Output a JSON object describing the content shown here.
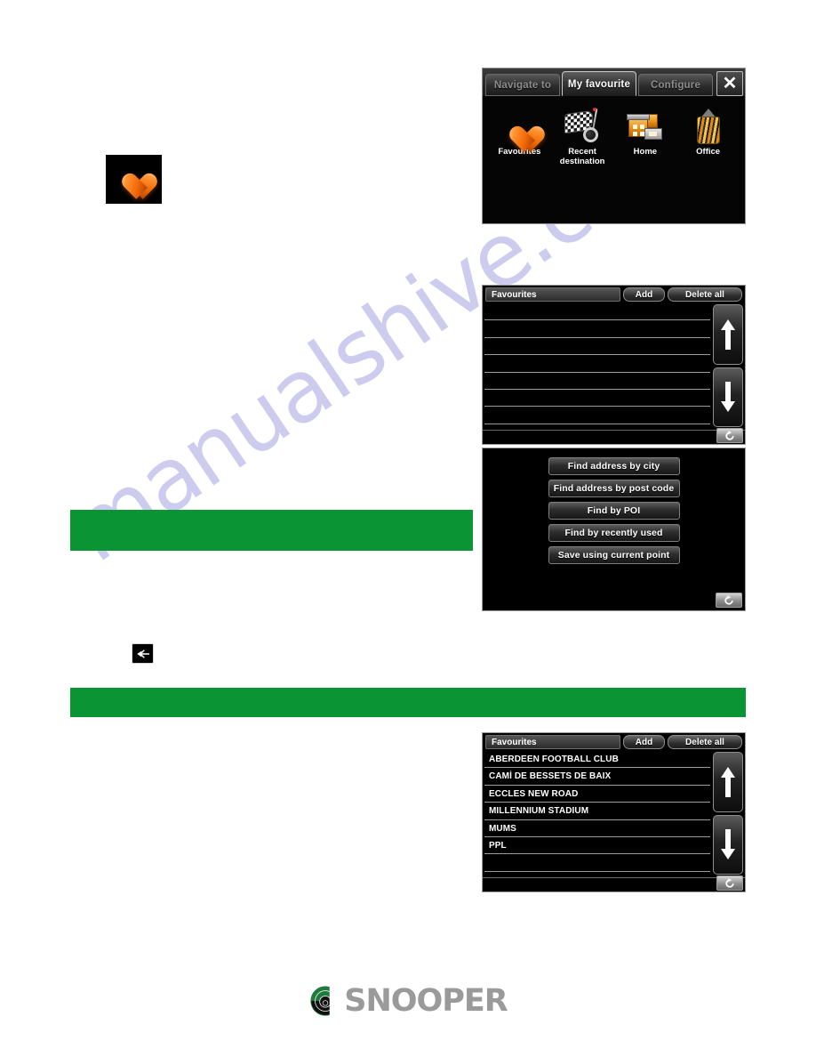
{
  "document": {
    "brand": "SNOOPER",
    "watermark": "manualshive.com"
  },
  "menu_panel": {
    "tabs": [
      {
        "label": "Navigate to",
        "active": false
      },
      {
        "label": "My favourite",
        "active": true
      },
      {
        "label": "Configure",
        "active": false
      }
    ],
    "close_label": "✕",
    "items": [
      {
        "label": "Favourites",
        "icon": "heart-icon"
      },
      {
        "label": "Recent destination",
        "icon": "checkered-flag-icon"
      },
      {
        "label": "Home",
        "icon": "home-icon"
      },
      {
        "label": "Office",
        "icon": "office-building-icon"
      }
    ]
  },
  "favourites_empty": {
    "title": "Favourites",
    "add_label": "Add",
    "delete_all_label": "Delete all",
    "rows": [
      "",
      "",
      "",
      "",
      "",
      "",
      ""
    ],
    "scroll_up_icon": "arrow-up-icon",
    "scroll_down_icon": "arrow-down-icon",
    "back_icon": "refresh-back-icon"
  },
  "find_panel": {
    "buttons": [
      "Find address by city",
      "Find address by post code",
      "Find by POI",
      "Find by recently used",
      "Save using current point"
    ],
    "back_icon": "refresh-back-icon"
  },
  "favourites_list": {
    "title": "Favourites",
    "add_label": "Add",
    "delete_all_label": "Delete all",
    "rows": [
      "ABERDEEN FOOTBALL CLUB",
      "CAMİ DE BESSETS DE BAIX",
      "ECCLES NEW ROAD",
      "MILLENNIUM STADIUM",
      "MUMS",
      "PPL",
      ""
    ],
    "scroll_up_icon": "arrow-up-icon",
    "scroll_down_icon": "arrow-down-icon",
    "back_icon": "refresh-back-icon"
  },
  "inline_icons": {
    "favourites_heart": "heart-icon",
    "back_arrow": "back-arrow-icon"
  },
  "colors": {
    "redaction_green": "#0a9434",
    "panel_black": "#000000",
    "accent_orange": "#f26a0a",
    "logo_gray": "#9a9a9a",
    "logo_green": "#1f7a3d"
  }
}
